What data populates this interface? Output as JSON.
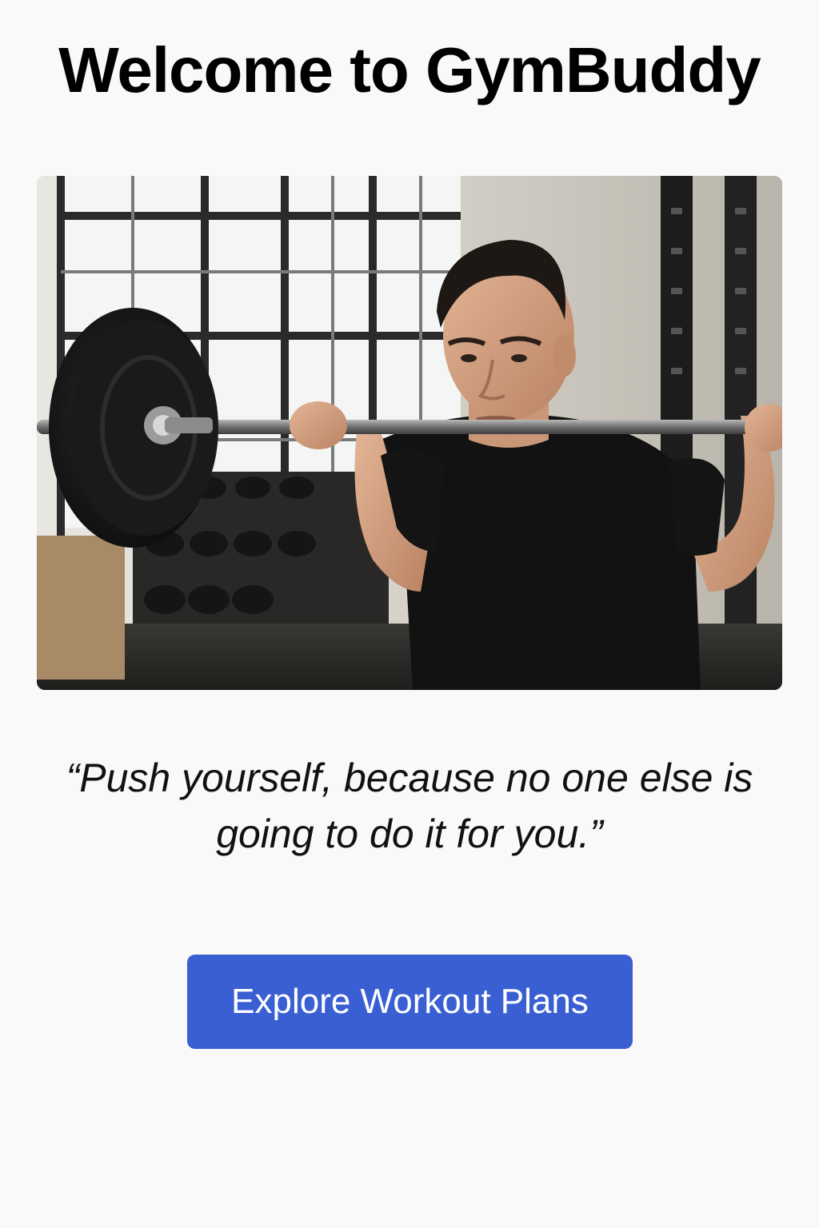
{
  "header": {
    "title": "Welcome to GymBuddy"
  },
  "hero": {
    "image_subject": "man-squatting-with-barbell-photo"
  },
  "quote": {
    "text": "“Push yourself, because no one else is going to do it for you.”"
  },
  "cta": {
    "label": "Explore Workout Plans"
  },
  "colors": {
    "background": "#f9f9f9",
    "title": "#000000",
    "button": "#3a5fd3",
    "button_text": "#ffffff"
  }
}
